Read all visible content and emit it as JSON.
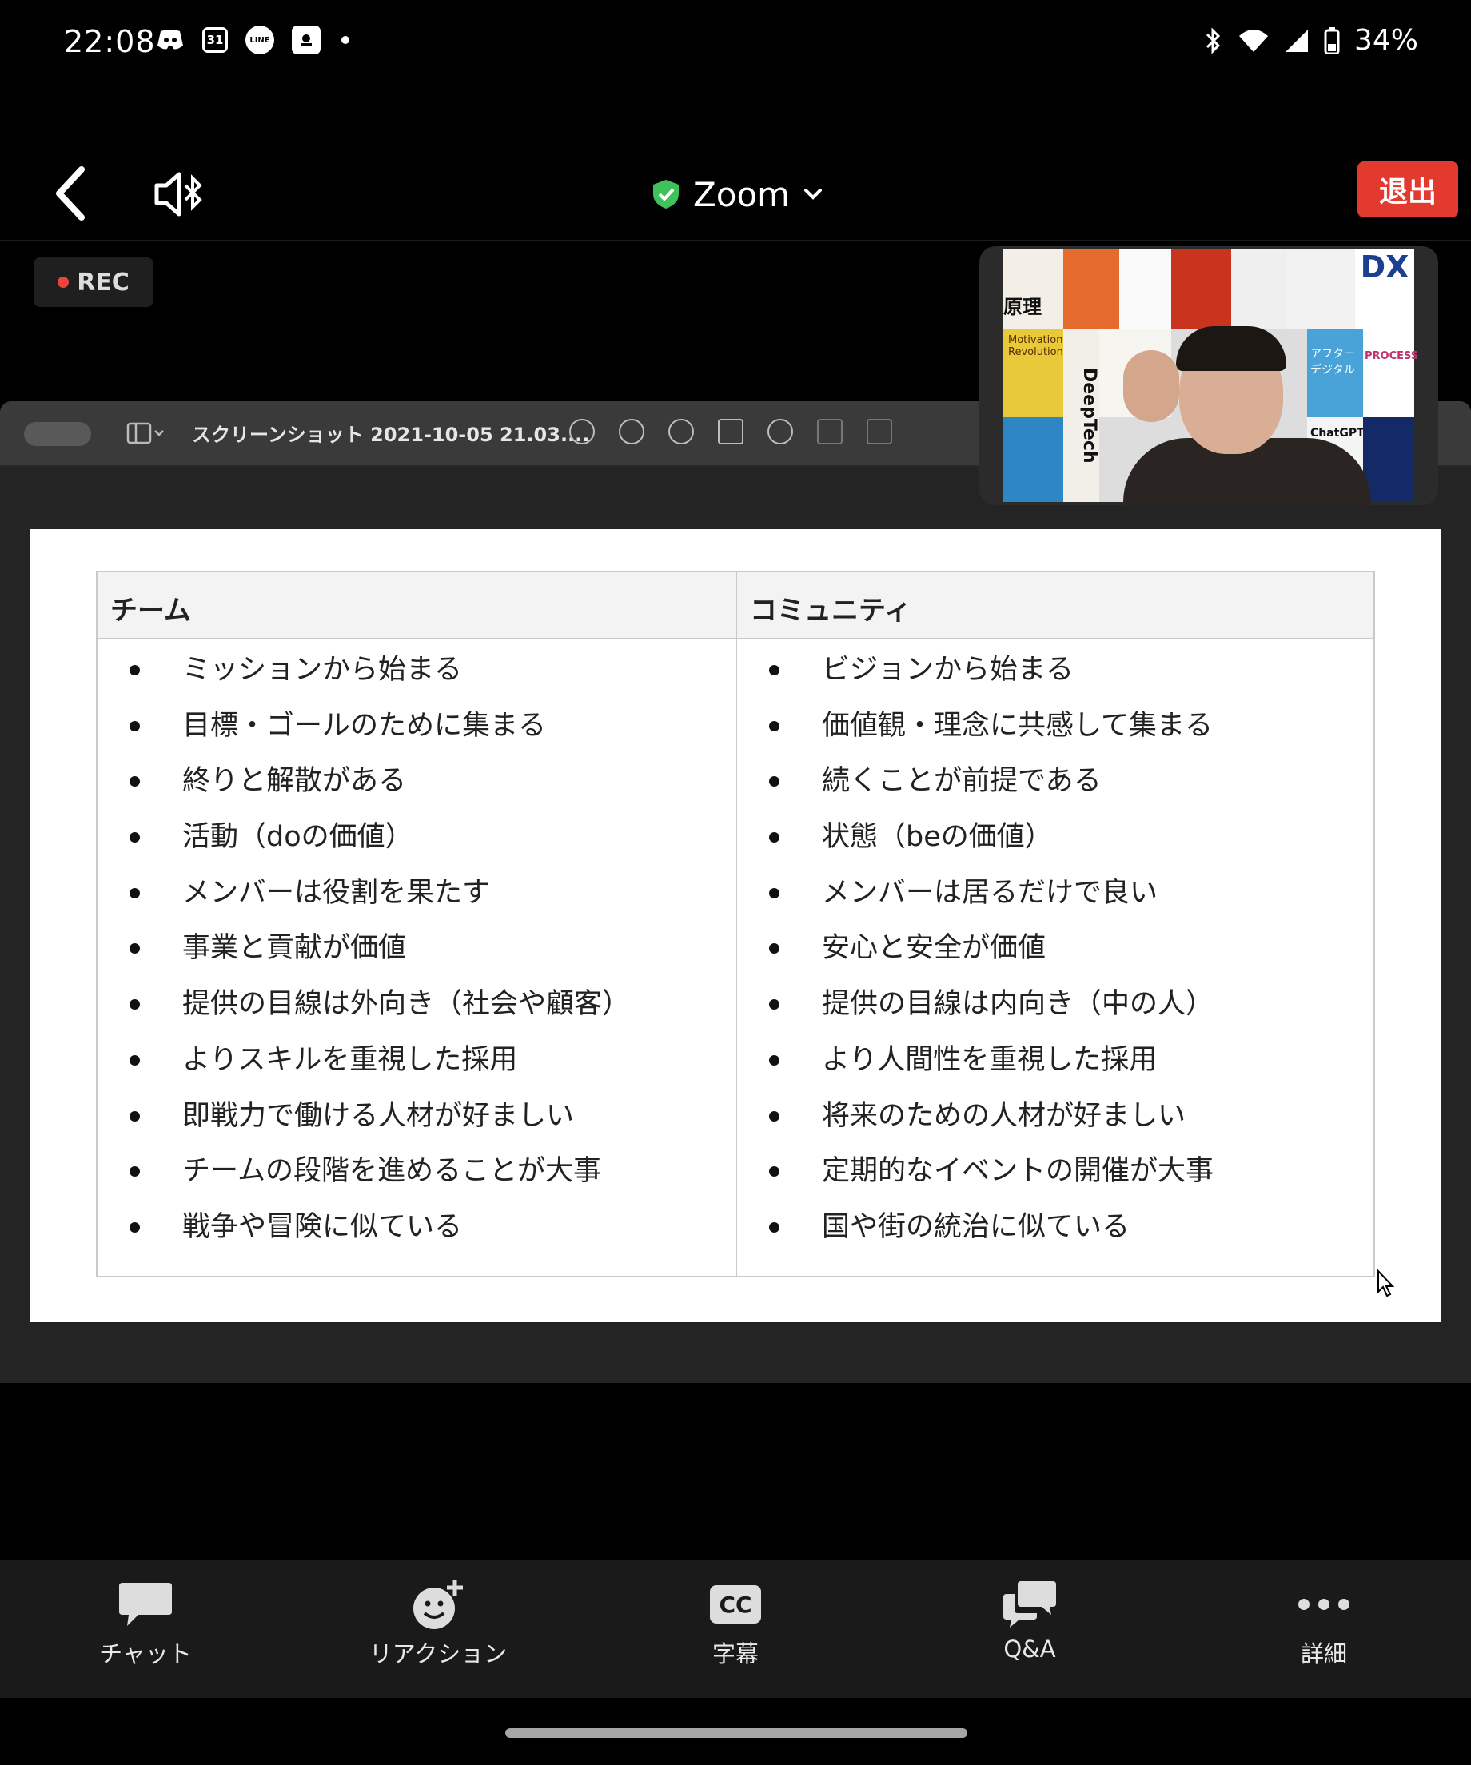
{
  "status_bar": {
    "time": "22:08",
    "notification_icons": [
      "discord-icon",
      "calendar-icon",
      "line-icon",
      "app-icon"
    ],
    "calendar_day": "31",
    "line_text": "LINE",
    "battery": "34%"
  },
  "meeting": {
    "title": "Zoom",
    "leave_label": "退出",
    "rec_label": "REC"
  },
  "shared_window": {
    "title": "スクリーンショット 2021-10-05 21.03....",
    "table": {
      "left_header": "チーム",
      "right_header": "コミュニティ",
      "left_items": [
        "ミッションから始まる",
        "目標・ゴールのために集まる",
        "終りと解散がある",
        "活動（doの価値）",
        "メンバーは役割を果たす",
        "事業と貢献が価値",
        "提供の目線は外向き（社会や顧客）",
        "よりスキルを重視した採用",
        "即戦力で働ける人材が好ましい",
        "チームの段階を進めることが大事",
        "戦争や冒険に似ている"
      ],
      "right_items": [
        "ビジョンから始まる",
        "価値観・理念に共感して集まる",
        "続くことが前提である",
        "状態（beの価値）",
        "メンバーは居るだけで良い",
        "安心と安全が価値",
        "提供の目線は内向き（中の人）",
        "より人間性を重視した採用",
        "将来のための人材が好ましい",
        "定期的なイベントの開催が大事",
        "国や街の統治に似ている"
      ]
    }
  },
  "video": {
    "book_titles": [
      "原理",
      "DX",
      "DeepTech",
      "Motivation Revolution",
      "ChatGPT",
      "PROCESS",
      "アフターデジタル"
    ]
  },
  "bottom_bar": {
    "chat": "チャット",
    "reaction": "リアクション",
    "captions": "字幕",
    "captions_icon_text": "CC",
    "qa": "Q&A",
    "more": "詳細"
  },
  "colors": {
    "leave_red": "#e33a30",
    "secure_green": "#3ec25a",
    "rec_red": "#e8453c"
  }
}
